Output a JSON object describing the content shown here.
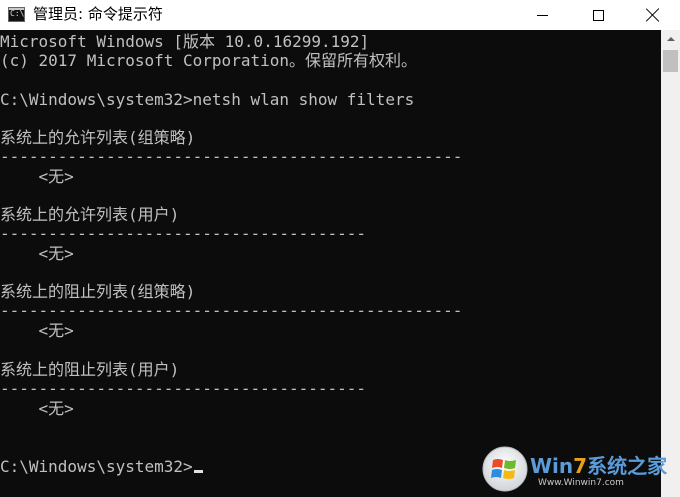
{
  "window": {
    "title": "管理员: 命令提示符",
    "icon_label": "C:\\",
    "icon": "cmd-icon"
  },
  "controls": {
    "minimize_icon": "minimize-icon",
    "maximize_icon": "maximize-icon",
    "close_icon": "close-icon"
  },
  "console": {
    "lines": [
      "Microsoft Windows [版本 10.0.16299.192]",
      "(c) 2017 Microsoft Corporation。保留所有权利。",
      "",
      "C:\\Windows\\system32>netsh wlan show filters",
      "",
      "系统上的允许列表(组策略)",
      "------------------------------------------------",
      "    <无>",
      "",
      "系统上的允许列表(用户)",
      "--------------------------------------",
      "    <无>",
      "",
      "系统上的阻止列表(组策略)",
      "------------------------------------------------",
      "    <无>",
      "",
      "系统上的阻止列表(用户)",
      "--------------------------------------",
      "    <无>",
      "",
      "",
      "C:\\Windows\\system32>"
    ]
  },
  "watermark": {
    "brand": "Win7系统之家",
    "url": "Www.Winwin7.com"
  },
  "colors": {
    "console_bg": "#0c0c0c",
    "console_text": "#c0c0c0",
    "titlebar_bg": "#ffffff"
  }
}
